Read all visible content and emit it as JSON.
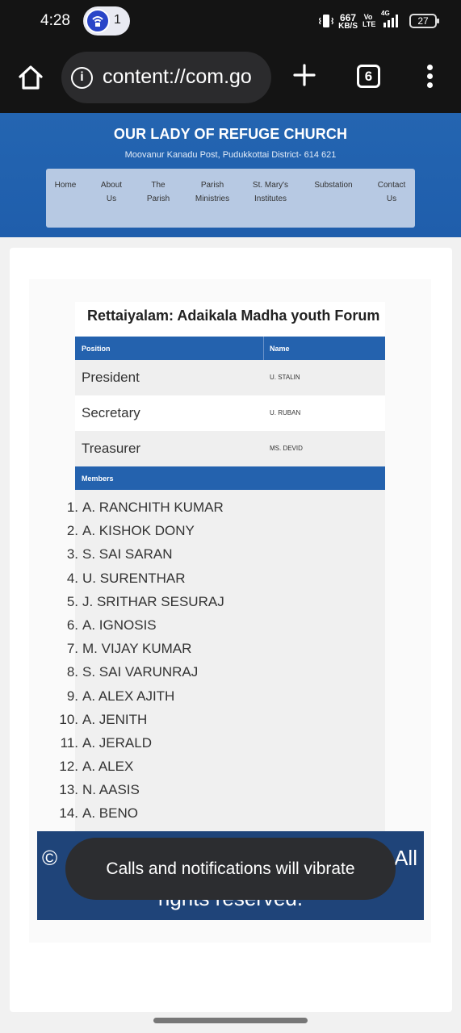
{
  "status_bar": {
    "time": "4:28",
    "notification_count": "1",
    "net_speed_value": "667",
    "net_speed_unit": "KB/S",
    "volte": "Vo LTE",
    "network": "4G",
    "battery": "27"
  },
  "browser": {
    "url": "content://com.go",
    "tab_count": "6"
  },
  "site": {
    "title": "OUR LADY OF REFUGE CHURCH",
    "subtitle": "Moovanur Kanadu Post, Pudukkottai District- 614 621",
    "nav": [
      {
        "label": "Home"
      },
      {
        "label": "About Us"
      },
      {
        "label": "The Parish"
      },
      {
        "label": "Parish Ministries"
      },
      {
        "label": "St. Mary's Institutes"
      },
      {
        "label": "Substation"
      },
      {
        "label": "Contact Us"
      }
    ]
  },
  "forum": {
    "title": "Rettaiyalam: Adaikala Madha youth Forum",
    "columns": {
      "position": "Position",
      "name": "Name"
    },
    "officers": [
      {
        "position": "President",
        "name": "U. STALIN"
      },
      {
        "position": "Secretary",
        "name": "U. RUBAN"
      },
      {
        "position": "Treasurer",
        "name": "MS. DEVID"
      }
    ],
    "members_label": "Members",
    "members": [
      "A. RANCHITH KUMAR",
      "A. KISHOK DONY",
      "S. SAI SARAN",
      "U. SURENTHAR",
      "J. SRITHAR SESURAJ",
      "A. IGNOSIS",
      "M. VIJAY KUMAR",
      "S. SAI VARUNRAJ",
      "A. ALEX AJITH",
      "A. JENITH",
      "A. JERALD",
      "A. ALEX",
      "N. AASIS",
      "A. BENO"
    ]
  },
  "footer": {
    "copyright_symbol": "©",
    "all_text": "All",
    "rights_text": "rights reserved."
  },
  "toast": {
    "message": "Calls and notifications will vibrate"
  }
}
